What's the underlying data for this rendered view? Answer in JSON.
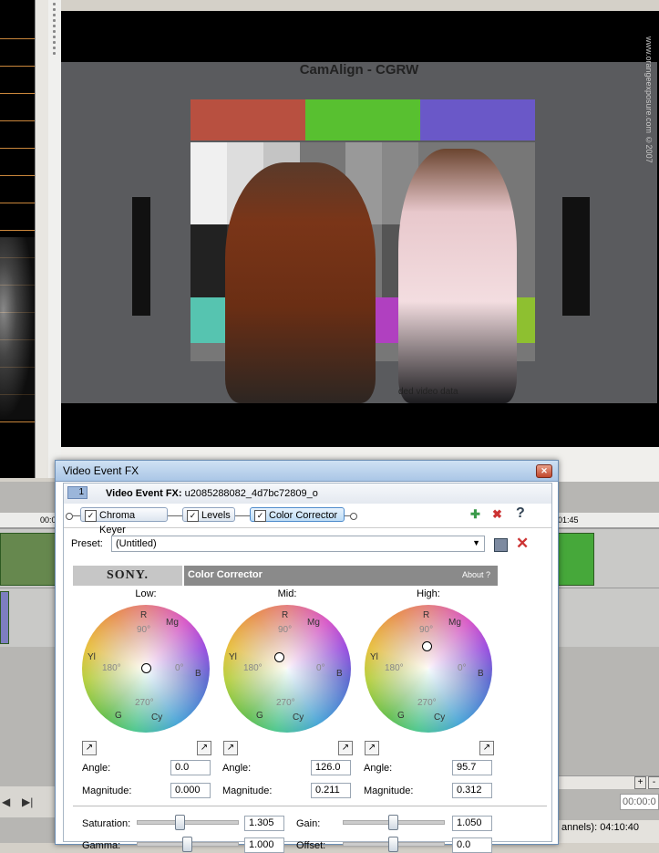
{
  "preview": {
    "chart_title": "CamAlign - CGRW",
    "watermark": "www.orangeexposure.com  ©2007",
    "chart_text": "ded video data"
  },
  "timeline": {
    "ruler_left": "00:0",
    "ruler_right": "01:45",
    "timecode_field": "00:00:0",
    "status": "annels): 04:10:40"
  },
  "dialog": {
    "window_title": "Video Event FX",
    "event_number": "1",
    "fx_label": "Video Event FX:",
    "fx_name": "u2085288082_4d7bc72809_o",
    "chain": [
      {
        "label": "Chroma Keyer",
        "checked": true
      },
      {
        "label": "Levels",
        "checked": true
      },
      {
        "label": "Color Corrector",
        "checked": true
      }
    ],
    "help_glyph": "?",
    "preset_label": "Preset:",
    "preset_value": "(Untitled)",
    "brand": "SONY.",
    "plugin_title": "Color Corrector",
    "about_label": "About  ?",
    "wheels": [
      {
        "title": "Low:",
        "angle": "0.0",
        "magnitude": "0.000"
      },
      {
        "title": "Mid:",
        "angle": "126.0",
        "magnitude": "0.211"
      },
      {
        "title": "High:",
        "angle": "95.7",
        "magnitude": "0.312"
      }
    ],
    "wheel_marks": {
      "r": "R",
      "mg": "Mg",
      "yl": "Yl",
      "b": "B",
      "g": "G",
      "cy": "Cy",
      "d90": "90°",
      "d180": "180°",
      "d0": "0°",
      "d270": "270°"
    },
    "angle_label": "Angle:",
    "magnitude_label": "Magnitude:",
    "saturation_label": "Saturation:",
    "saturation_value": "1.305",
    "gamma_label": "Gamma:",
    "gamma_value": "1.000",
    "gain_label": "Gain:",
    "gain_value": "1.050",
    "offset_label": "Offset:",
    "offset_value": "0.0"
  }
}
